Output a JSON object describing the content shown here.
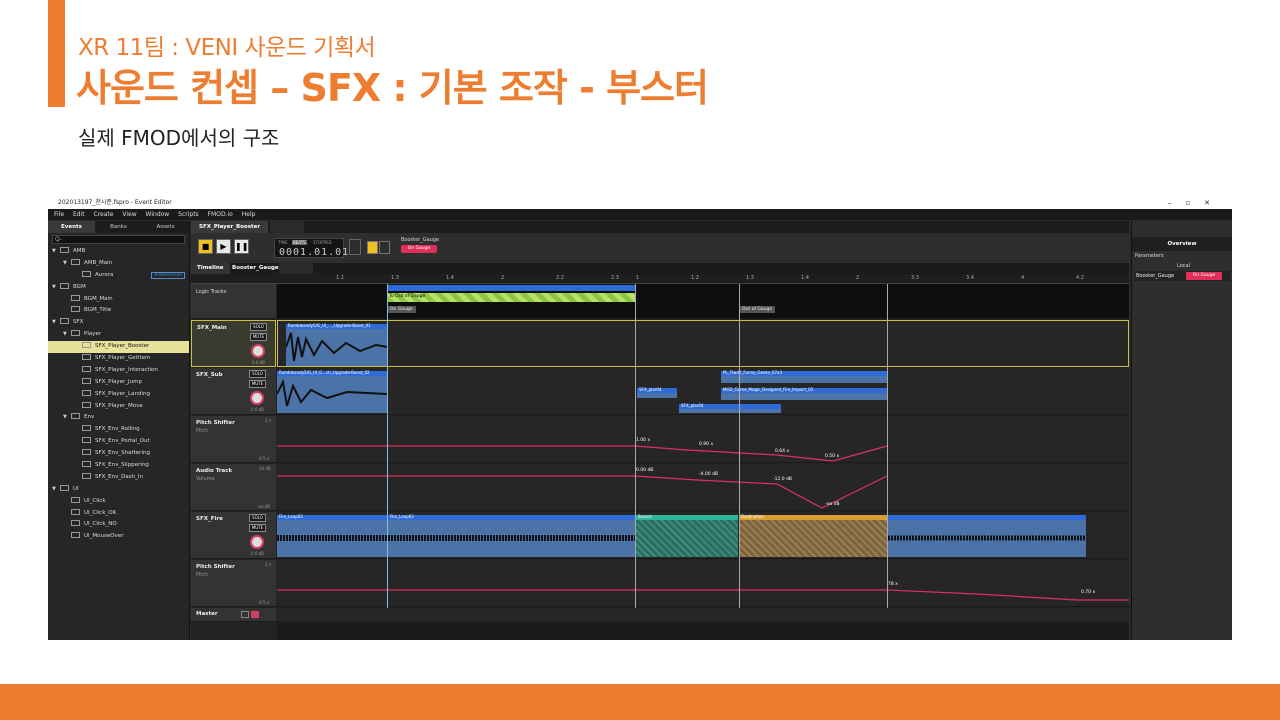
{
  "slide": {
    "subtitle": "XR 11팀 : VENI 사운드 기획서",
    "title": "사운드 컨셉 – SFX : 기본 조작 - 부스터",
    "description": "실제 FMOD에서의 구조"
  },
  "app": {
    "window_title": "202013197_천시준.fspro - Event Editor",
    "window_controls": [
      "–",
      "▫",
      "✕"
    ],
    "menu": [
      "File",
      "Edit",
      "Create",
      "View",
      "Window",
      "Scripts",
      "FMOD.io",
      "Help"
    ]
  },
  "browser": {
    "tabs": [
      "Events",
      "Banks",
      "Assets"
    ],
    "search_placeholder": "Q-",
    "tree": [
      {
        "label": "AMB",
        "depth": 0,
        "kind": "folder",
        "expanded": true
      },
      {
        "label": "AMB_Main",
        "depth": 1,
        "kind": "folder",
        "expanded": true
      },
      {
        "label": "Aurora",
        "depth": 2,
        "kind": "event",
        "tag": "#referenced"
      },
      {
        "label": "BGM",
        "depth": 0,
        "kind": "folder",
        "expanded": true
      },
      {
        "label": "BGM_Main",
        "depth": 1,
        "kind": "event"
      },
      {
        "label": "BGM_Title",
        "depth": 1,
        "kind": "event"
      },
      {
        "label": "SFX",
        "depth": 0,
        "kind": "folder",
        "expanded": true
      },
      {
        "label": "Player",
        "depth": 1,
        "kind": "folder",
        "expanded": true
      },
      {
        "label": "SFX_Player_Booster",
        "depth": 2,
        "kind": "event",
        "selected": true
      },
      {
        "label": "SFX_Player_GetItem",
        "depth": 2,
        "kind": "event"
      },
      {
        "label": "SFX_Player_Interaction",
        "depth": 2,
        "kind": "event"
      },
      {
        "label": "SFX_Player_Jump",
        "depth": 2,
        "kind": "event"
      },
      {
        "label": "SFX_Player_Landing",
        "depth": 2,
        "kind": "event"
      },
      {
        "label": "SFX_Player_Move",
        "depth": 2,
        "kind": "event"
      },
      {
        "label": "Env",
        "depth": 1,
        "kind": "folder",
        "expanded": true
      },
      {
        "label": "SFX_Env_Rolling",
        "depth": 2,
        "kind": "event"
      },
      {
        "label": "SFX_Env_Portal_Out",
        "depth": 2,
        "kind": "event"
      },
      {
        "label": "SFX_Env_Shattering",
        "depth": 2,
        "kind": "event"
      },
      {
        "label": "SFX_Env_Slippering",
        "depth": 2,
        "kind": "event"
      },
      {
        "label": "SFX_Env_Dash_In",
        "depth": 2,
        "kind": "event"
      },
      {
        "label": "UI",
        "depth": 0,
        "kind": "folder",
        "expanded": true
      },
      {
        "label": "UI_Click",
        "depth": 1,
        "kind": "event"
      },
      {
        "label": "UI_Click_OK",
        "depth": 1,
        "kind": "event"
      },
      {
        "label": "UI_Click_NO",
        "depth": 1,
        "kind": "event"
      },
      {
        "label": "UI_MouseOver",
        "depth": 1,
        "kind": "event"
      }
    ]
  },
  "editor": {
    "tab": "SFX_Player_Booster",
    "timecode": "0001.01.01",
    "lcd_labels": [
      "TIME",
      "BEATS",
      "STOPPED"
    ],
    "param_name": "Booster_Gauge",
    "param_value": "On Gauge",
    "subtabs": [
      "Timeline",
      "Booster_Gauge"
    ],
    "ruler_left": [
      "1.2",
      "1.3",
      "1.4",
      "2",
      "2.2",
      "2.3"
    ],
    "ruler_mid": [
      "1",
      "1.2",
      "1.3",
      "1.4",
      "2"
    ],
    "ruler_right": [
      "3.3",
      "3.4",
      "4",
      "4.2"
    ],
    "logic_label": "Logic Tracks",
    "logic_region": "To Out of Gauge",
    "markers": [
      "On Gauge",
      "Out of Gauge"
    ],
    "tracks": [
      {
        "name": "SFX_Main",
        "vol": "0.0 dB",
        "clips": [
          "Rumbleandy5/G_UI_..._Upgrade-Boost_01"
        ]
      },
      {
        "name": "SFX_Sub",
        "vol": "0.0 dB",
        "clips": [
          "Rumbleandy5/G_UI_G...ch_Upgrade-Boost_02",
          "PL_Tiwd0_Funny_Geeks_07a3",
          "MGD_Game_Magic_Designed_Fire_Impact_05",
          "SFX_plar04",
          "SFX_plar04"
        ]
      },
      {
        "name": "SFX_Fire",
        "vol": "0.0 dB",
        "clips": [
          "Fire_Loop03",
          "Fire_Loop03",
          "Source",
          "Destination"
        ]
      }
    ],
    "auto_pitch": {
      "name": "Pitch Shifter",
      "sub": "Pitch",
      "max": "2 x",
      "min": "0.5 x",
      "values": [
        "1.00 x",
        "0.90 x",
        "0.64 x",
        "0.50 x"
      ]
    },
    "auto_volume": {
      "name": "Audio Track",
      "sub": "Volume",
      "max": "10 dB",
      "min": "-oo dB",
      "values": [
        "0.00 dB",
        "-4.00 dB",
        "-12.0 dB",
        "-oo dB"
      ]
    },
    "auto_pitch2": {
      "name": "Pitch Shifter",
      "sub": "Pitch",
      "max": "2 x",
      "min": "0.5 x",
      "values": [
        "78 x",
        "0.70 x"
      ]
    },
    "master_label": "Master",
    "solo_label": "SOLO",
    "mute_label": "MUTE"
  },
  "overview": {
    "title": "Overview",
    "section": "Parameters",
    "scope": "Local",
    "param_name": "Booster_Gauge",
    "param_value": "On Gauge"
  },
  "colors": {
    "accent": "#ed7d31",
    "clip": "#4b73a8",
    "automation": "#e03060",
    "selected": "#e6e29a"
  }
}
